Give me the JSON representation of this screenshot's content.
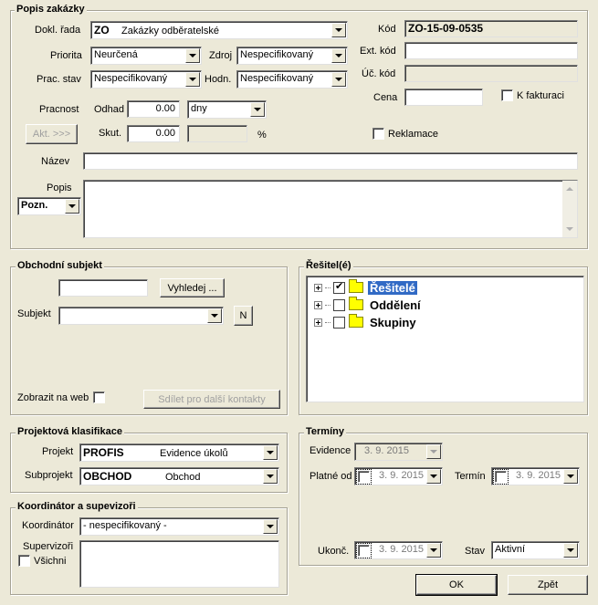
{
  "popis": {
    "legend": "Popis zakázky",
    "dokl_rada_label": "Dokl. řada",
    "dokl_rada_code": "ZO",
    "dokl_rada_value": "Zakázky odběratelské",
    "priorita_label": "Priorita",
    "priorita_value": "Neurčená",
    "zdroj_label": "Zdroj",
    "zdroj_value": "Nespecifikovaný",
    "prac_stav_label": "Prac. stav",
    "prac_stav_value": "Nespecifikovaný",
    "hodn_label": "Hodn.",
    "hodn_value": "Nespecifikovaný",
    "kod_label": "Kód",
    "kod_value": "ZO-15-09-0535",
    "ext_kod_label": "Ext. kód",
    "ext_kod_value": "",
    "uc_kod_label": "Úč. kód",
    "uc_kod_value": "",
    "cena_label": "Cena",
    "cena_value": "",
    "k_fakturaci_label": "K fakturaci",
    "pracnost_label": "Pracnost",
    "odhad_label": "Odhad",
    "odhad_value": "0.00",
    "jednotka_value": "dny",
    "akt_button": "Akt. >>>",
    "skut_label": "Skut.",
    "skut_value": "0.00",
    "procento_value": "",
    "percent_sign": "%",
    "reklamace_label": "Reklamace",
    "nazev_label": "Název",
    "nazev_value": "",
    "popis_label": "Popis",
    "popis_type": "Pozn.",
    "popis_value": ""
  },
  "subjekt": {
    "legend": "Obchodní subjekt",
    "search_value": "",
    "vyhledej_button": "Vyhledej ...",
    "subjekt_label": "Subjekt",
    "subjekt_value": "",
    "n_button": "N",
    "zobrazit_label": "Zobrazit na web",
    "sdilet_button": "Sdílet pro další kontakty"
  },
  "resitele": {
    "legend": "Řešitel(é)",
    "nodes": [
      {
        "label": "Řešitelé",
        "checked": true,
        "selected": true
      },
      {
        "label": "Oddělení",
        "checked": false,
        "selected": false
      },
      {
        "label": "Skupiny",
        "checked": false,
        "selected": false
      }
    ]
  },
  "projekt": {
    "legend": "Projektová klasifikace",
    "projekt_label": "Projekt",
    "projekt_code": "PROFIS",
    "projekt_value": "Evidence úkolů",
    "subprojekt_label": "Subprojekt",
    "subprojekt_code": "OBCHOD",
    "subprojekt_value": "Obchod"
  },
  "koordinator": {
    "legend": "Koordinátor a supevizoři",
    "koordinator_label": "Koordinátor",
    "koordinator_value": "- nespecifikovaný -",
    "supervizori_label": "Supervizoři",
    "vsichni_label": "Všichni",
    "list_value": ""
  },
  "terminy": {
    "legend": "Termíny",
    "evidence_label": "Evidence",
    "evidence_value": "3. 9. 2015",
    "platne_od_label": "Platné od",
    "platne_od_value": "3. 9. 2015",
    "termin_label": "Termín",
    "termin_value": "3. 9. 2015",
    "ukonc_label": "Ukonč.",
    "ukonc_value": "3. 9. 2015",
    "stav_label": "Stav",
    "stav_value": "Aktivní"
  },
  "footer": {
    "ok_button": "OK",
    "zpet_button": "Zpět"
  }
}
